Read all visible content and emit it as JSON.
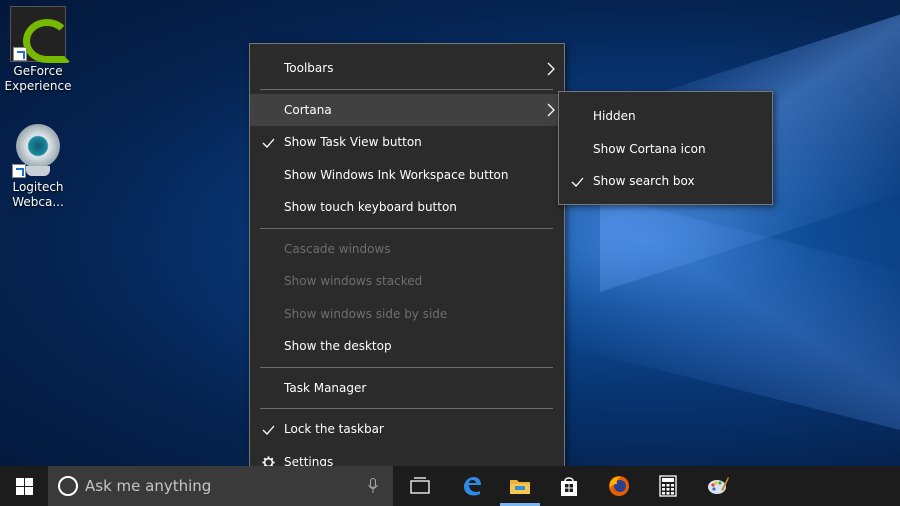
{
  "desktop": {
    "icons": [
      {
        "label_line1": "GeForce",
        "label_line2": "Experience",
        "icon": "nvidia-geforce-icon"
      },
      {
        "label_line1": "Logitech",
        "label_line2": "Webca...",
        "icon": "webcam-icon"
      }
    ]
  },
  "context_menu": {
    "toolbars": "Toolbars",
    "cortana": "Cortana",
    "show_task_view": "Show Task View button",
    "show_ink": "Show Windows Ink Workspace button",
    "show_touch_keyboard": "Show touch keyboard button",
    "cascade": "Cascade windows",
    "stacked": "Show windows stacked",
    "side_by_side": "Show windows side by side",
    "show_desktop": "Show the desktop",
    "task_manager": "Task Manager",
    "lock_taskbar": "Lock the taskbar",
    "settings": "Settings"
  },
  "cortana_submenu": {
    "hidden": "Hidden",
    "show_icon": "Show Cortana icon",
    "show_search_box": "Show search box"
  },
  "taskbar": {
    "search_placeholder": "Ask me anything"
  }
}
